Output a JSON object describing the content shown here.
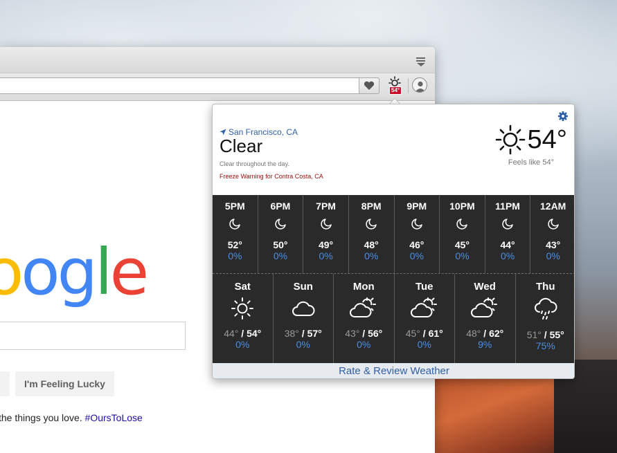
{
  "browser": {
    "search_placeholder": "",
    "lucky_button_label": "I'm Feeling Lucky",
    "footer_text": "the things you love. ",
    "footer_link": "#OursToLose",
    "extension_badge": "54°"
  },
  "weather": {
    "location": "San Francisco, CA",
    "condition": "Clear",
    "summary": "Clear throughout the day.",
    "alert": "Freeze Warning for Contra Costa, CA",
    "current_temp": "54°",
    "feels_like": "Feels like 54°",
    "rate_label": "Rate & Review Weather",
    "hourly": [
      {
        "time": "5PM",
        "temp": "52°",
        "precip": "0%",
        "icon": "moon-icon"
      },
      {
        "time": "6PM",
        "temp": "50°",
        "precip": "0%",
        "icon": "moon-icon"
      },
      {
        "time": "7PM",
        "temp": "49°",
        "precip": "0%",
        "icon": "moon-icon"
      },
      {
        "time": "8PM",
        "temp": "48°",
        "precip": "0%",
        "icon": "moon-icon"
      },
      {
        "time": "9PM",
        "temp": "46°",
        "precip": "0%",
        "icon": "moon-icon"
      },
      {
        "time": "10PM",
        "temp": "45°",
        "precip": "0%",
        "icon": "moon-icon"
      },
      {
        "time": "11PM",
        "temp": "44°",
        "precip": "0%",
        "icon": "moon-icon"
      },
      {
        "time": "12AM",
        "temp": "43°",
        "precip": "0%",
        "icon": "moon-icon"
      }
    ],
    "daily": [
      {
        "day": "Sat",
        "low": "44°",
        "high": "54°",
        "precip": "0%",
        "icon": "sun-icon"
      },
      {
        "day": "Sun",
        "low": "38°",
        "high": "57°",
        "precip": "0%",
        "icon": "cloud-icon"
      },
      {
        "day": "Mon",
        "low": "43°",
        "high": "56°",
        "precip": "0%",
        "icon": "partly-cloudy-icon"
      },
      {
        "day": "Tue",
        "low": "45°",
        "high": "61°",
        "precip": "0%",
        "icon": "partly-cloudy-icon"
      },
      {
        "day": "Wed",
        "low": "48°",
        "high": "62°",
        "precip": "9%",
        "icon": "partly-cloudy-icon"
      },
      {
        "day": "Thu",
        "low": "51°",
        "high": "55°",
        "precip": "75%",
        "icon": "rain-icon"
      }
    ]
  },
  "colors": {
    "accent": "#2f5fa7",
    "precip": "#4a8fe6",
    "alert": "#a01010",
    "panel": "#2a2a2a"
  }
}
